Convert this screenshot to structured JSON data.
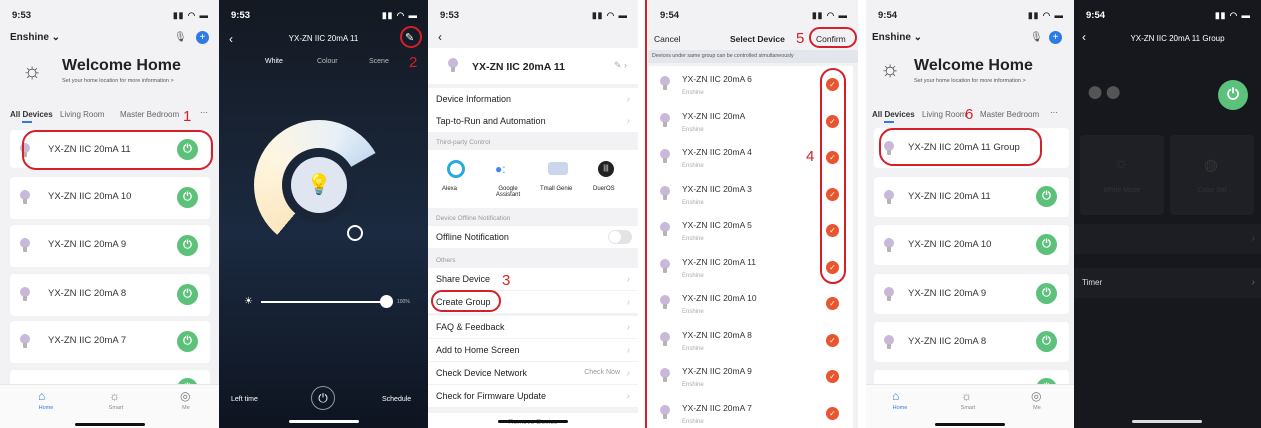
{
  "panel1": {
    "time": "9:53",
    "home": "Enshine",
    "welcome": "Welcome Home",
    "set_location": "Set your home location for more information",
    "tabs": [
      "All Devices",
      "Living Room",
      "Master Bedroom",
      "···"
    ],
    "devices": [
      "YX-ZN IIC 20mA 11",
      "YX-ZN IIC 20mA 10",
      "YX-ZN IIC 20mA 9",
      "YX-ZN IIC 20mA 8",
      "YX-ZN IIC 20mA 7"
    ],
    "step": "1",
    "nav": [
      "Home",
      "Smart",
      "Me"
    ]
  },
  "panel2": {
    "time": "9:53",
    "title": "YX-ZN IIC 20mA 11",
    "tabs": [
      "White",
      "Colour",
      "Scene"
    ],
    "step": "2",
    "brightness": "100%",
    "brightness_level": 1.0,
    "left_time": "Left time",
    "schedule": "Schedule"
  },
  "panel3": {
    "time": "9:53",
    "device_name": "YX-ZN IIC 20mA 11",
    "rows_top": [
      "Device Information",
      "Tap-to-Run and Automation"
    ],
    "sec_third": "Third-party Control",
    "third_party": [
      "Alexa",
      "Google Assistant",
      "Tmall Genie",
      "DuerOS"
    ],
    "sec_offline": "Device Offline Notification",
    "offline_label": "Offline Notification",
    "sec_others": "Others",
    "rows_others": [
      "Share Device",
      "Create Group",
      "FAQ & Feedback",
      "Add to Home Screen",
      "Check Device Network",
      "Check for Firmware Update"
    ],
    "check_now": "Check Now",
    "step": "3",
    "remove": "Remove Device"
  },
  "panel4": {
    "time": "9:54",
    "cancel": "Cancel",
    "title": "Select Device",
    "confirm": "Confirm",
    "notice": "Devices under same group can be controlled simultaneously",
    "devices": [
      "YX-ZN IIC 20mA 6",
      "YX-ZN IIC 20mA",
      "YX-ZN IIC 20mA 4",
      "YX-ZN IIC 20mA 3",
      "YX-ZN IIC 20mA 5",
      "YX-ZN IIC 20mA 11",
      "YX-ZN IIC 20mA 10",
      "YX-ZN IIC 20mA 8",
      "YX-ZN IIC 20mA 9",
      "YX-ZN IIC 20mA 7"
    ],
    "sub": "Enshine",
    "step4": "4",
    "step5": "5"
  },
  "panel5": {
    "time": "9:54",
    "home": "Enshine",
    "welcome": "Welcome Home",
    "set_location": "Set your home location for more information",
    "tabs": [
      "All Devices",
      "Living Room",
      "Master Bedroom",
      "···"
    ],
    "group": "YX-ZN IIC 20mA 11 Group",
    "devices": [
      "YX-ZN IIC 20mA 11",
      "YX-ZN IIC 20mA 10",
      "YX-ZN IIC 20mA 9",
      "YX-ZN IIC 20mA 8"
    ],
    "step": "6",
    "nav": [
      "Home",
      "Smart",
      "Me"
    ]
  },
  "panel6": {
    "time": "9:54",
    "title": "YX-ZN IIC 20mA 11 Group",
    "tiles": [
      "White Mode",
      "Color Set"
    ],
    "timer": "Timer"
  },
  "colors": {
    "accent": "#d4202a",
    "power": "#5bc17b",
    "check": "#e8552e"
  }
}
